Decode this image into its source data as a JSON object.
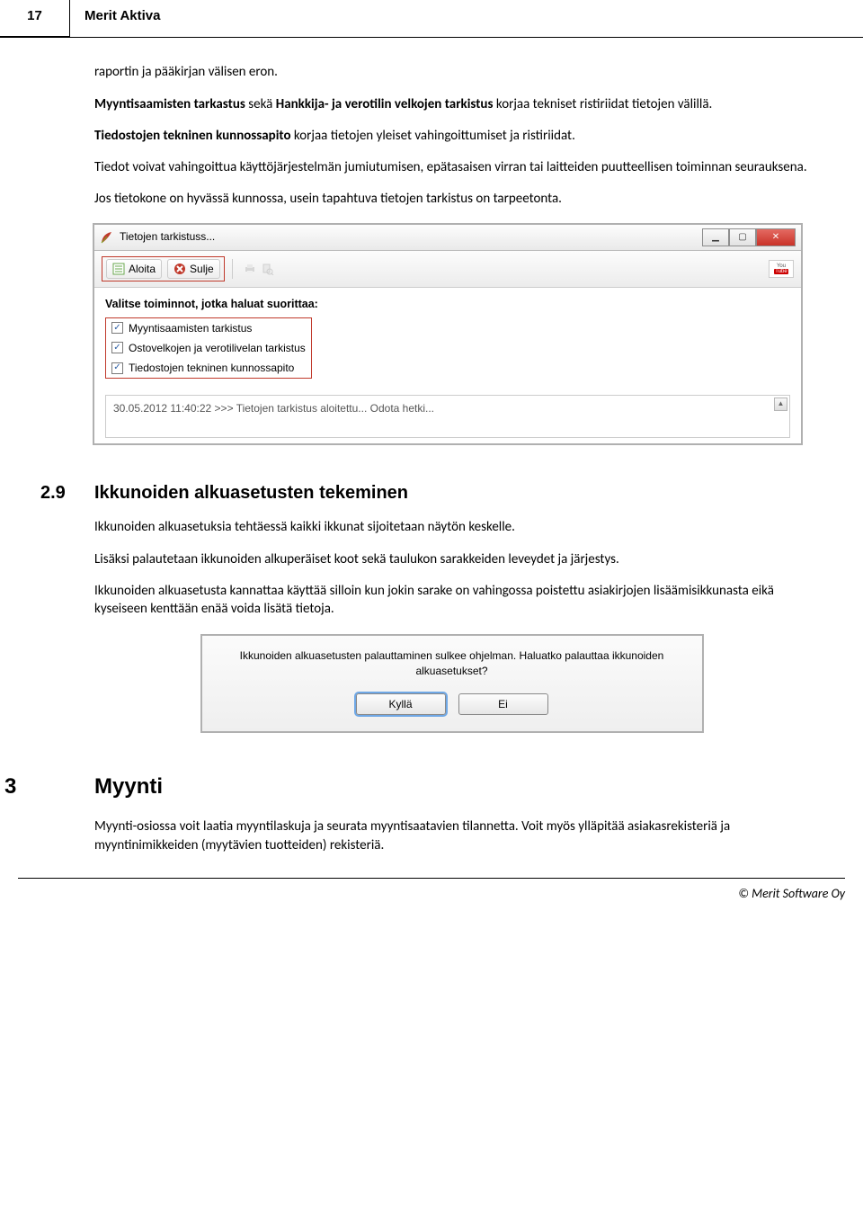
{
  "header": {
    "page_number": "17",
    "doc_title": "Merit Aktiva"
  },
  "intro": {
    "p1": "raportin ja pääkirjan välisen eron.",
    "p2a": "Myyntisaamisten tarkastus",
    "p2b": " sekä ",
    "p2c": "Hankkija- ja verotilin velkojen tarkistus",
    "p2d": " korjaa tekniset ristiriidat tietojen välillä.",
    "p3a": "Tiedostojen tekninen kunnossapito",
    "p3b": " korjaa tietojen yleiset vahingoittumiset ja ristiriidat.",
    "p4": "Tiedot voivat vahingoittua käyttöjärjestelmän jumiutumisen, epätasaisen virran tai laitteiden puutteellisen toiminnan seurauksena.",
    "p5": "Jos tietokone on hyvässä kunnossa, usein tapahtuva tietojen tarkistus on tarpeetonta."
  },
  "win": {
    "title": "Tietojen tarkistuss...",
    "aloita": "Aloita",
    "sulje": "Sulje",
    "prompt": "Valitse toiminnot, jotka haluat suorittaa:",
    "chk1": "Myyntisaamisten tarkistus",
    "chk2": "Ostovelkojen ja verotilivelan tarkistus",
    "chk3": "Tiedostojen tekninen kunnossapito",
    "log": "30.05.2012 11:40:22 >>> Tietojen tarkistus aloitettu... Odota hetki...",
    "youtube_you": "You",
    "youtube_tube": "Tube"
  },
  "section29": {
    "num": "2.9",
    "title": "Ikkunoiden alkuasetusten tekeminen",
    "p1": "Ikkunoiden alkuasetuksia tehtäessä kaikki ikkunat sijoitetaan näytön keskelle.",
    "p2": "Lisäksi palautetaan ikkunoiden alkuperäiset koot sekä taulukon sarakkeiden leveydet ja järjestys.",
    "p3": "Ikkunoiden alkuasetusta kannattaa käyttää silloin kun jokin sarake on vahingossa poistettu asiakirjojen lisäämisikkunasta eikä kyseiseen kenttään enää voida lisätä tietoja."
  },
  "dialog": {
    "msg": "Ikkunoiden alkuasetusten palauttaminen sulkee ohjelman. Haluatko palauttaa ikkunoiden alkuasetukset?",
    "yes": "Kyllä",
    "no": "Ei"
  },
  "section3": {
    "num": "3",
    "title": "Myynti",
    "p1": "Myynti-osiossa voit laatia myyntilaskuja ja seurata myyntisaatavien tilannetta. Voit myös ylläpitää asiakasrekisteriä ja myyntinimikkeiden (myytävien tuotteiden) rekisteriä."
  },
  "footer": {
    "copyright": "© Merit Software Oy"
  }
}
